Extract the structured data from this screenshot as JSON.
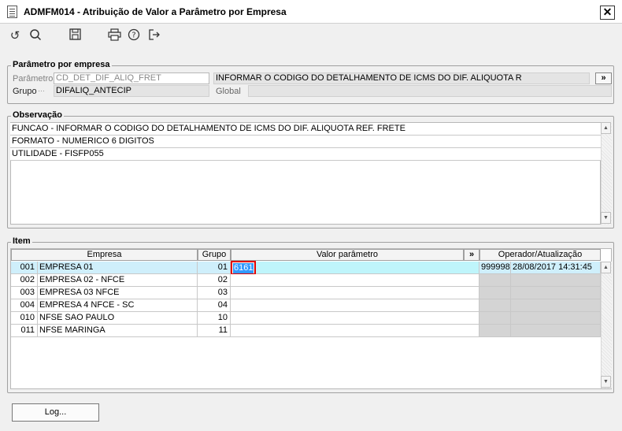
{
  "window": {
    "title": "ADMFM014 - Atribuição de Valor a Parâmetro por Empresa",
    "close_glyph": "✕"
  },
  "toolbar": {
    "icons": [
      "undo-icon",
      "search-icon",
      "save-icon",
      "print-icon",
      "help-icon",
      "exit-icon"
    ]
  },
  "parametro_group": {
    "label": "Parâmetro por empresa",
    "parametro_label": "Parâmetro",
    "parametro_value": "CD_DET_DIF_ALIQ_FRET",
    "description": "INFORMAR O CODIGO DO DETALHAMENTO DE ICMS DO DIF. ALIQUOTA R",
    "more_button": "»",
    "grupo_label": "Grupo",
    "grupo_value": "DIFALIQ_ANTECIP",
    "global_label": "Global",
    "global_value": ""
  },
  "observacao": {
    "label": "Observação",
    "lines": [
      "FUNCAO - INFORMAR O CODIGO DO DETALHAMENTO DE ICMS DO DIF. ALIQUOTA REF. FRETE",
      "FORMATO - NUMERICO 6 DIGITOS",
      "UTILIDADE - FISFP055"
    ]
  },
  "item": {
    "label": "Item",
    "headers": {
      "empresa": "Empresa",
      "grupo": "Grupo",
      "valor": "Valor parâmetro",
      "more": "»",
      "operador": "Operador/Atualização"
    },
    "rows": [
      {
        "code": "001",
        "name": "EMPRESA 01",
        "grupo": "01",
        "valor": "6161",
        "operador": "999998",
        "data": "28/08/2017 14:31:45"
      },
      {
        "code": "002",
        "name": "EMPRESA 02 - NFCE",
        "grupo": "02",
        "valor": "",
        "operador": "",
        "data": ""
      },
      {
        "code": "003",
        "name": "EMPRESA 03 NFCE",
        "grupo": "03",
        "valor": "",
        "operador": "",
        "data": ""
      },
      {
        "code": "004",
        "name": "EMPRESA 4 NFCE - SC",
        "grupo": "04",
        "valor": "",
        "operador": "",
        "data": ""
      },
      {
        "code": "010",
        "name": "NFSE SAO PAULO",
        "grupo": "10",
        "valor": "",
        "operador": "",
        "data": ""
      },
      {
        "code": "011",
        "name": "NFSE MARINGA",
        "grupo": "11",
        "valor": "",
        "operador": "",
        "data": ""
      }
    ]
  },
  "footer": {
    "log_button": "Log..."
  }
}
